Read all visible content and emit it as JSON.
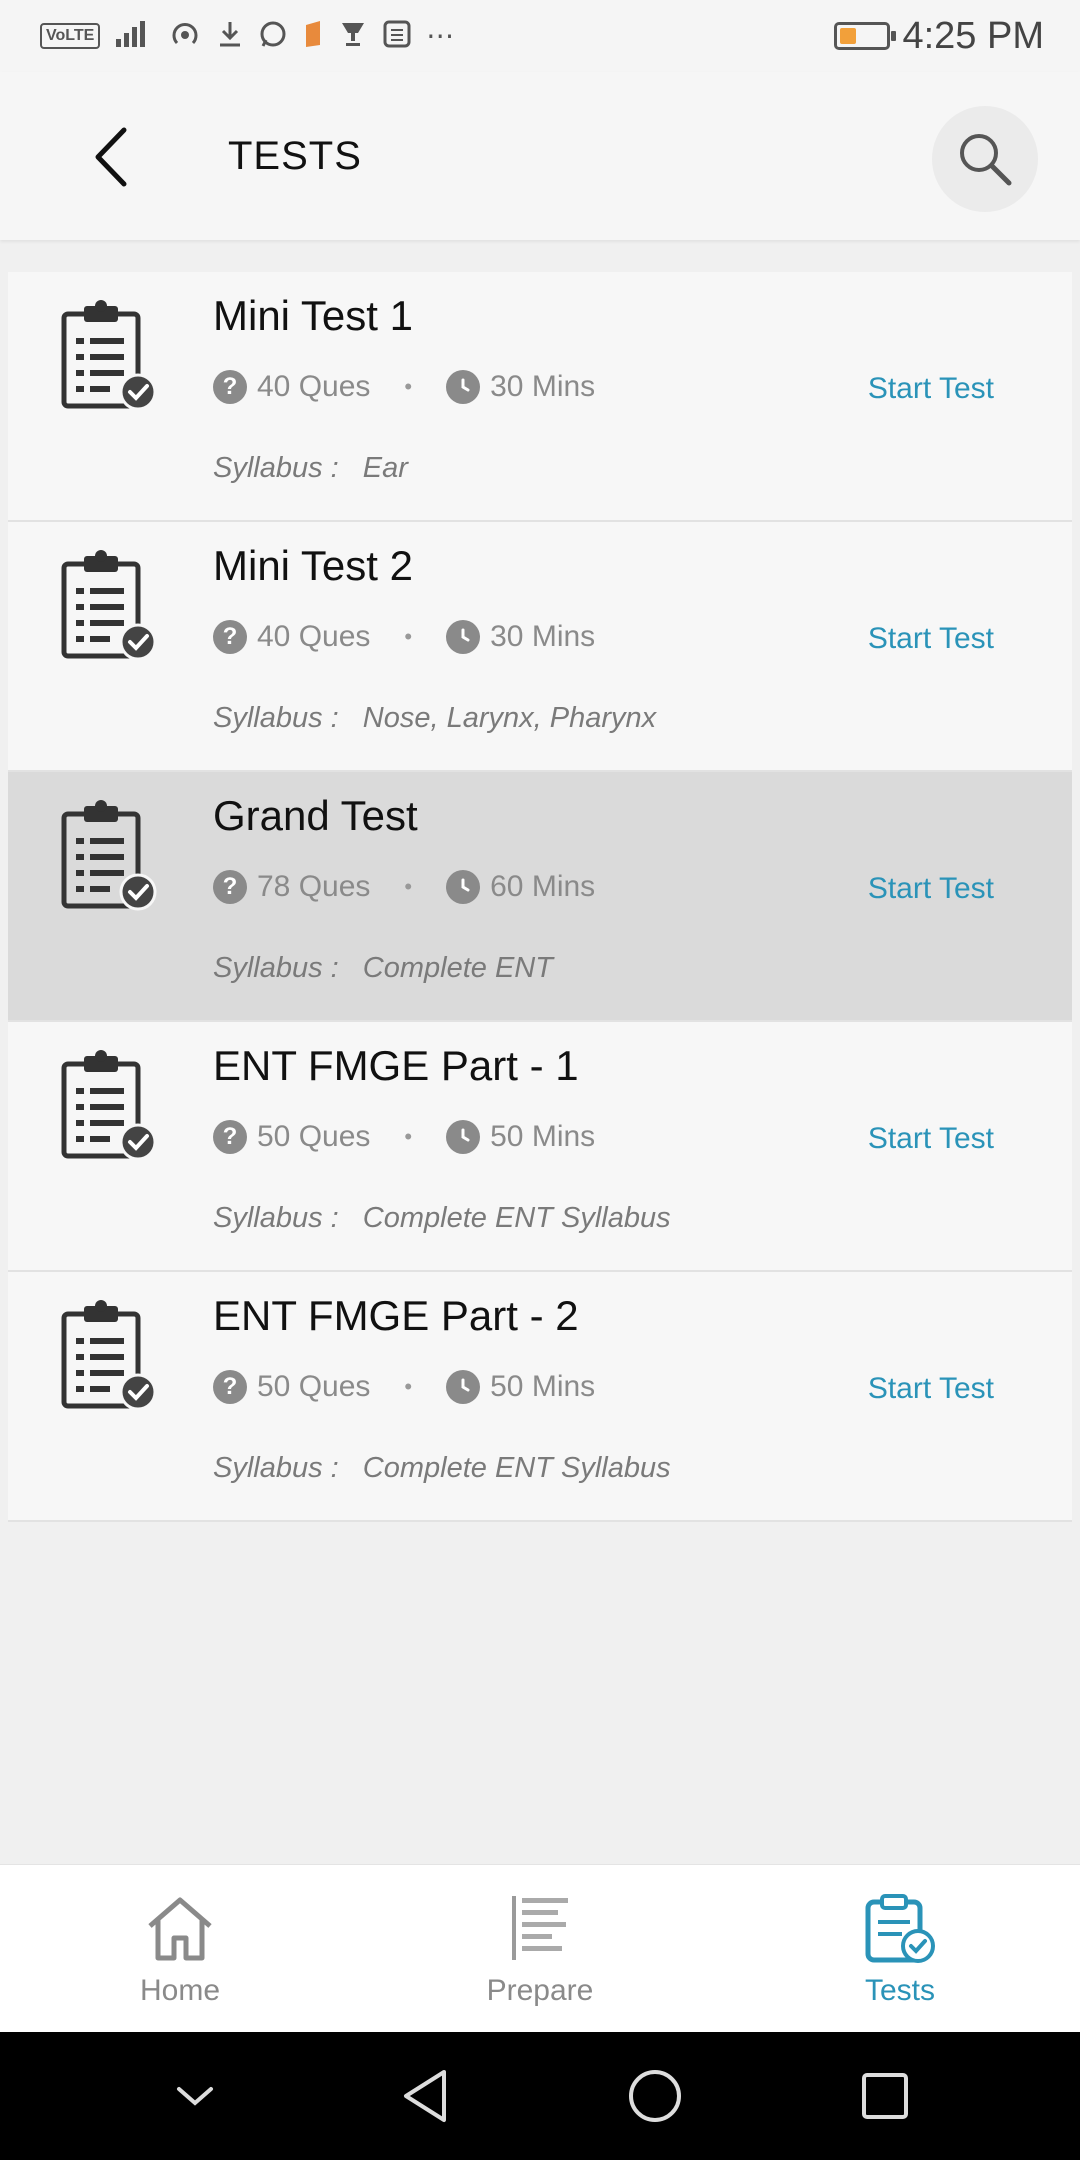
{
  "status_bar": {
    "time": "4:25 PM",
    "icons": [
      "volte-icon",
      "signal-4g-icon",
      "hotspot-icon",
      "download-icon",
      "whatsapp-icon",
      "app-icon",
      "trophy-icon",
      "calculator-icon",
      "more-icon"
    ],
    "volte_label": "VoLTE",
    "battery_level": 0.36
  },
  "header": {
    "title": "TESTS"
  },
  "tests": [
    {
      "name": "Mini Test 1",
      "questions": "40 Ques",
      "duration": "30 Mins",
      "action": "Start Test",
      "syllabus_label": "Syllabus :",
      "syllabus": "Ear"
    },
    {
      "name": "Mini Test 2",
      "questions": "40 Ques",
      "duration": "30 Mins",
      "action": "Start Test",
      "syllabus_label": "Syllabus :",
      "syllabus": "Nose, Larynx, Pharynx"
    },
    {
      "name": "Grand Test",
      "questions": "78 Ques",
      "duration": "60 Mins",
      "action": "Start Test",
      "syllabus_label": "Syllabus :",
      "syllabus": "Complete ENT"
    },
    {
      "name": "ENT FMGE Part - 1",
      "questions": "50 Ques",
      "duration": "50 Mins",
      "action": "Start Test",
      "syllabus_label": "Syllabus :",
      "syllabus": "Complete ENT Syllabus"
    },
    {
      "name": "ENT FMGE Part - 2",
      "questions": "50 Ques",
      "duration": "50 Mins",
      "action": "Start Test",
      "syllabus_label": "Syllabus :",
      "syllabus": "Complete ENT Syllabus"
    }
  ],
  "bottom_nav": {
    "items": [
      {
        "label": "Home",
        "icon": "home-icon"
      },
      {
        "label": "Prepare",
        "icon": "prepare-icon"
      },
      {
        "label": "Tests",
        "icon": "tests-icon",
        "active": true
      }
    ]
  },
  "colors": {
    "accent": "#2a93b8",
    "highlight_row": "#dadada",
    "muted_text": "#8a8a8a"
  }
}
